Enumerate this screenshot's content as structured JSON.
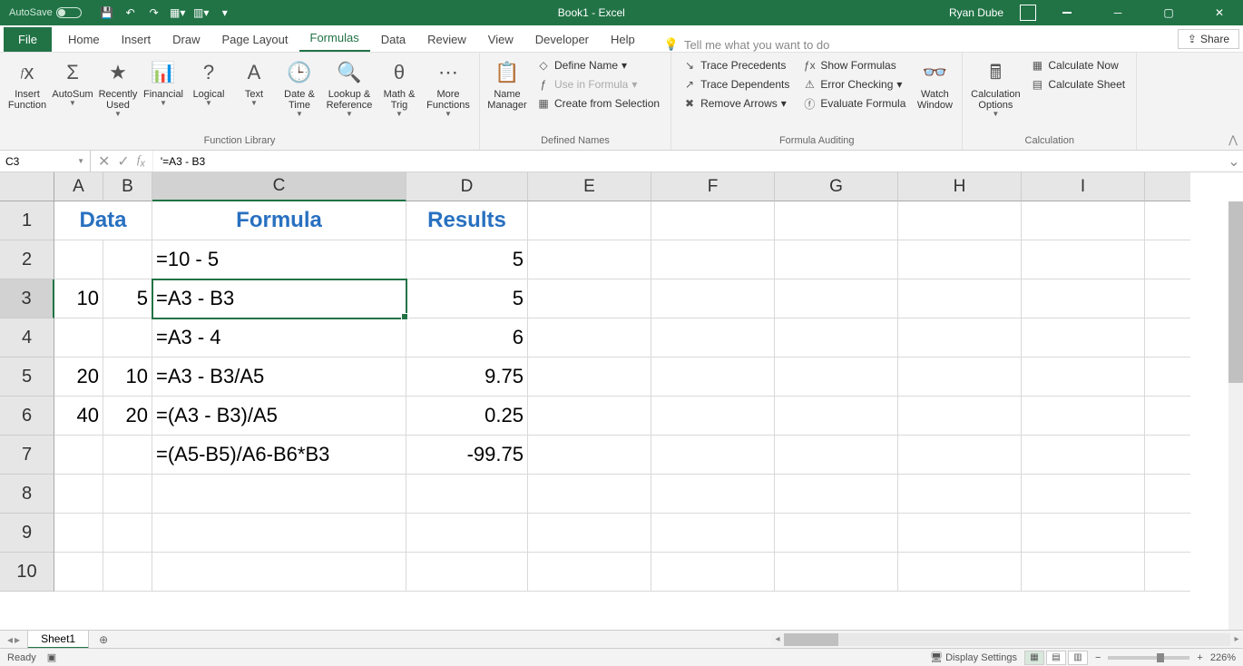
{
  "titlebar": {
    "autosave_label": "AutoSave",
    "title": "Book1 - Excel",
    "user": "Ryan Dube"
  },
  "tabs": {
    "file": "File",
    "home": "Home",
    "insert": "Insert",
    "draw": "Draw",
    "page_layout": "Page Layout",
    "formulas": "Formulas",
    "data": "Data",
    "review": "Review",
    "view": "View",
    "developer": "Developer",
    "help": "Help",
    "tellme": "Tell me what you want to do",
    "share": "Share"
  },
  "ribbon": {
    "function_library": {
      "label": "Function Library",
      "insert_function": "Insert Function",
      "autosum": "AutoSum",
      "recently_used": "Recently Used",
      "financial": "Financial",
      "logical": "Logical",
      "text": "Text",
      "date_time": "Date & Time",
      "lookup_reference": "Lookup & Reference",
      "math_trig": "Math & Trig",
      "more_functions": "More Functions"
    },
    "defined_names": {
      "label": "Defined Names",
      "name_manager": "Name Manager",
      "define_name": "Define Name",
      "use_in_formula": "Use in Formula",
      "create_from_selection": "Create from Selection"
    },
    "formula_auditing": {
      "label": "Formula Auditing",
      "trace_precedents": "Trace Precedents",
      "trace_dependents": "Trace Dependents",
      "remove_arrows": "Remove Arrows",
      "show_formulas": "Show Formulas",
      "error_checking": "Error Checking",
      "evaluate_formula": "Evaluate Formula",
      "watch_window": "Watch Window"
    },
    "calculation": {
      "label": "Calculation",
      "calculation_options": "Calculation Options",
      "calculate_now": "Calculate Now",
      "calculate_sheet": "Calculate Sheet"
    }
  },
  "namebox": "C3",
  "formula_bar": "'=A3 - B3",
  "columns": [
    "A",
    "B",
    "C",
    "D",
    "E",
    "F",
    "G",
    "H",
    "I"
  ],
  "row_count": 10,
  "selected": {
    "row": 3,
    "col": "C"
  },
  "cells": {
    "r1": {
      "AB_merge": "Data",
      "C": "Formula",
      "D": "Results"
    },
    "r2": {
      "C": "=10 - 5",
      "D": "5"
    },
    "r3": {
      "A": "10",
      "B": "5",
      "C": "=A3 - B3",
      "D": "5"
    },
    "r4": {
      "C": "=A3 - 4",
      "D": "6"
    },
    "r5": {
      "A": "20",
      "B": "10",
      "C": "=A3 - B3/A5",
      "D": "9.75"
    },
    "r6": {
      "A": "40",
      "B": "20",
      "C": "=(A3 - B3)/A5",
      "D": "0.25"
    },
    "r7": {
      "C": "=(A5-B5)/A6-B6*B3",
      "D": "-99.75"
    }
  },
  "sheet_tabs": {
    "sheet1": "Sheet1"
  },
  "statusbar": {
    "ready": "Ready",
    "display_settings": "Display Settings",
    "zoom": "226%"
  }
}
